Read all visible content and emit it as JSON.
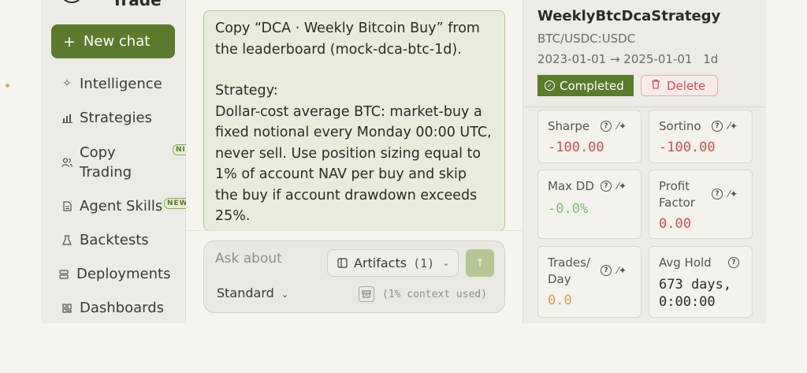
{
  "sidebar": {
    "brand": "Trade",
    "new_chat_label": "New chat",
    "items": [
      {
        "label": "Intelligence",
        "icon": "sparkle-icon"
      },
      {
        "label": "Strategies",
        "icon": "chart-icon"
      },
      {
        "label": "Copy Trading",
        "icon": "users-icon",
        "badge": "NI"
      },
      {
        "label": "Agent Skills",
        "icon": "document-icon",
        "badge": "NEW"
      },
      {
        "label": "Backtests",
        "icon": "flask-icon"
      },
      {
        "label": "Deployments",
        "icon": "server-icon"
      },
      {
        "label": "Dashboards",
        "icon": "grid-icon"
      }
    ]
  },
  "chat": {
    "message_line1": "Copy “DCA · Weekly Bitcoin Buy” from the leaderboard (mock-dca-btc-1d).",
    "message_line2": "Strategy:",
    "message_line3": "Dollar-cost average BTC: market-buy a fixed notional every Monday 00:00 UTC, never sell. Use position sizing equal to 1% of account NAV per buy and skip the buy if account drawdown exceeds 25%.",
    "composer": {
      "placeholder": "Ask about",
      "artifacts_label": "Artifacts",
      "artifacts_count": "(1)",
      "mode": "Standard",
      "context": "(1% context used)"
    }
  },
  "strategy": {
    "name": "WeeklyBtcDcaStrategy",
    "pair": "BTC/USDC:USDC",
    "range": "2023-01-01 → 2025-01-01",
    "timeframe": "1d",
    "status": "Completed",
    "delete_label": "Delete",
    "metrics": {
      "sharpe": {
        "label": "Sharpe",
        "value": "-100.00"
      },
      "sortino": {
        "label": "Sortino",
        "value": "-100.00"
      },
      "max_dd": {
        "label": "Max DD",
        "value": "-0.0%"
      },
      "profit_factor": {
        "label": "Profit Factor",
        "value": "0.00"
      },
      "trades_day": {
        "label": "Trades/ Day",
        "value": "0.0"
      },
      "avg_hold": {
        "label": "Avg Hold",
        "value": "673 days, 0:00:00"
      }
    }
  },
  "colors": {
    "accent": "#5b7a2c",
    "negative": "#d64f4f",
    "positive": "#7fbf6f",
    "neutral_value": "#e0a043"
  }
}
